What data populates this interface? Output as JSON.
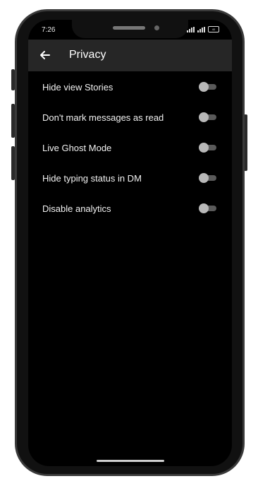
{
  "status_bar": {
    "time": "7:26",
    "battery_label": "40"
  },
  "header": {
    "back_icon": "arrow-left-icon",
    "title": "Privacy"
  },
  "settings": [
    {
      "label": "Hide view Stories",
      "enabled": false
    },
    {
      "label": "Don't mark messages as read",
      "enabled": false
    },
    {
      "label": "Live Ghost Mode",
      "enabled": false
    },
    {
      "label": "Hide typing status in DM",
      "enabled": false
    },
    {
      "label": "Disable analytics",
      "enabled": false
    }
  ],
  "colors": {
    "background": "#000000",
    "app_bar": "#262626",
    "toggle_off_thumb": "#b8b8b8",
    "toggle_off_track": "#5a5a5a"
  }
}
